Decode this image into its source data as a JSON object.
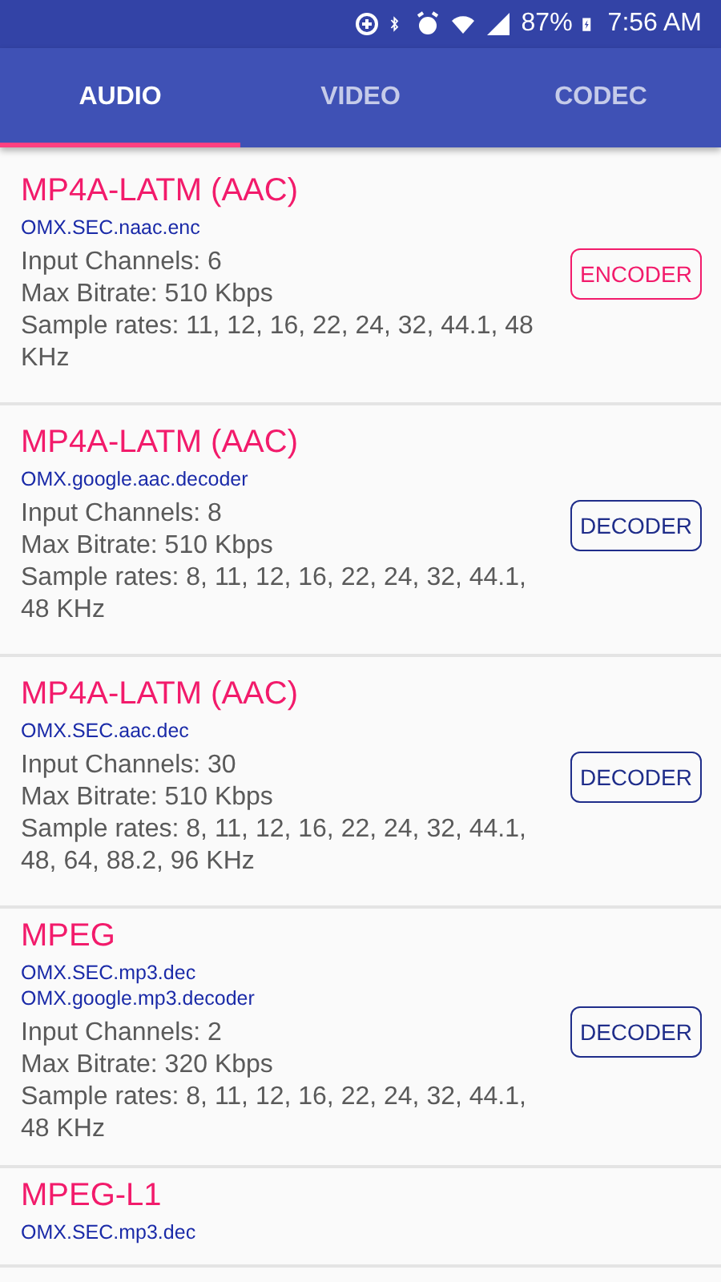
{
  "status_bar": {
    "battery": "87%",
    "time": "7:56 AM"
  },
  "tabs": [
    {
      "label": "AUDIO",
      "selected": true
    },
    {
      "label": "VIDEO",
      "selected": false
    },
    {
      "label": "CODEC",
      "selected": false
    }
  ],
  "codecs": [
    {
      "title": "MP4A-LATM (AAC)",
      "components": [
        "OMX.SEC.naac.enc"
      ],
      "details": [
        "Input Channels: 6",
        "Max Bitrate: 510 Kbps",
        "Sample rates: 11, 12, 16, 22, 24, 32, 44.1, 48 KHz"
      ],
      "kind": "encoder",
      "type_label": "ENCODER"
    },
    {
      "title": "MP4A-LATM (AAC)",
      "components": [
        "OMX.google.aac.decoder"
      ],
      "details": [
        "Input Channels: 8",
        "Max Bitrate: 510 Kbps",
        "Sample rates: 8, 11, 12, 16, 22, 24, 32, 44.1, 48 KHz"
      ],
      "kind": "decoder",
      "type_label": "DECODER"
    },
    {
      "title": "MP4A-LATM (AAC)",
      "components": [
        "OMX.SEC.aac.dec"
      ],
      "details": [
        "Input Channels: 30",
        "Max Bitrate: 510 Kbps",
        "Sample rates: 8, 11, 12, 16, 22, 24, 32, 44.1, 48, 64, 88.2, 96 KHz"
      ],
      "kind": "decoder",
      "type_label": "DECODER"
    },
    {
      "title": "MPEG",
      "components": [
        "OMX.SEC.mp3.dec",
        "OMX.google.mp3.decoder"
      ],
      "details": [
        "Input Channels: 2",
        "Max Bitrate: 320 Kbps",
        "Sample rates: 8, 11, 12, 16, 22, 24, 32, 44.1, 48 KHz"
      ],
      "kind": "decoder",
      "type_label": "DECODER"
    },
    {
      "title": "MPEG-L1",
      "components": [
        "OMX.SEC.mp3.dec"
      ]
    }
  ]
}
